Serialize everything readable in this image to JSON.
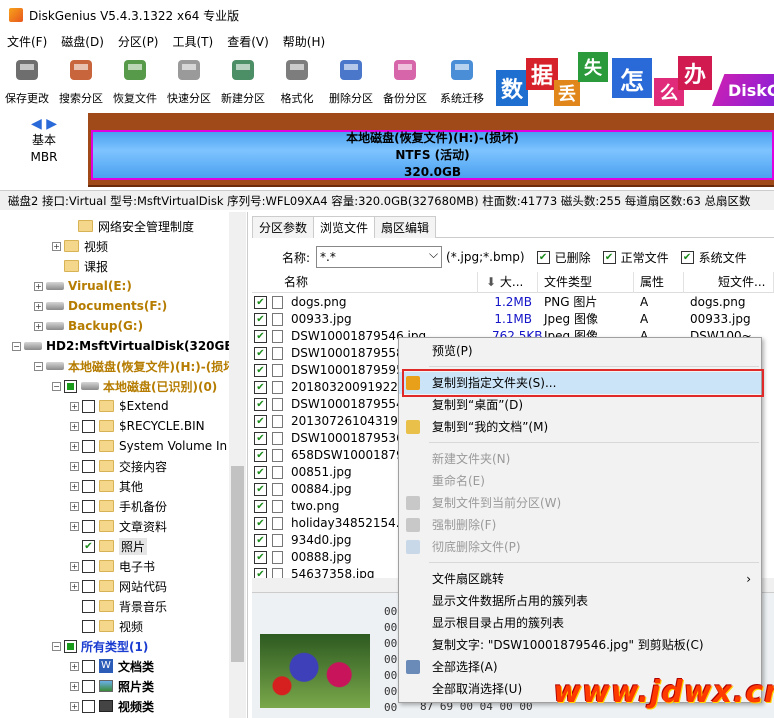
{
  "app": {
    "title": "DiskGenius V5.4.3.1322 x64 专业版"
  },
  "menu": [
    "文件(F)",
    "磁盘(D)",
    "分区(P)",
    "工具(T)",
    "查看(V)",
    "帮助(H)"
  ],
  "toolbar": [
    {
      "label": "保存更改",
      "icon": "save-disk-icon"
    },
    {
      "label": "搜索分区",
      "icon": "magnifier-icon"
    },
    {
      "label": "恢复文件",
      "icon": "recover-box-icon"
    },
    {
      "label": "快速分区",
      "icon": "disc-icon"
    },
    {
      "label": "新建分区",
      "icon": "layers-icon"
    },
    {
      "label": "格式化",
      "icon": "gear-disc-icon"
    },
    {
      "label": "删除分区",
      "icon": "trash-icon"
    },
    {
      "label": "备份分区",
      "icon": "pie-icon"
    },
    {
      "label": "系统迁移",
      "icon": "windows-migrate-icon"
    }
  ],
  "banner": {
    "chars": [
      "数",
      "据",
      "丢",
      "失",
      "怎",
      "么",
      "办"
    ],
    "text": "DiskG"
  },
  "disk": {
    "type_line1": "基本",
    "type_line2": "MBR",
    "partition_title": "本地磁盘(恢复文件)(H:)-(损坏)",
    "fs": "NTFS (活动)",
    "size": "320.0GB"
  },
  "infobar": "磁盘2 接口:Virtual  型号:MsftVirtualDisk  序列号:WFL09XA4  容量:320.0GB(327680MB)  柱面数:41773  磁头数:255  每道扇区数:63  总扇区数",
  "tree": [
    {
      "label": "网络安全管理制度",
      "indent": 66,
      "kind": "folder",
      "color": "#000"
    },
    {
      "label": "视频",
      "indent": 52,
      "kind": "folder",
      "exp": "+",
      "color": "#000"
    },
    {
      "label": "课报",
      "indent": 52,
      "kind": "folder",
      "color": "#000"
    },
    {
      "label": "Virual(E:)",
      "indent": 34,
      "kind": "drive",
      "exp": "+",
      "color": "#b57c00",
      "bold": true
    },
    {
      "label": "Documents(F:)",
      "indent": 34,
      "kind": "drive",
      "exp": "+",
      "color": "#b57c00",
      "bold": true
    },
    {
      "label": "Backup(G:)",
      "indent": 34,
      "kind": "drive",
      "exp": "+",
      "color": "#b57c00",
      "bold": true
    },
    {
      "label": "HD2:MsftVirtualDisk(320GB)",
      "indent": 12,
      "kind": "hdd",
      "exp": "−",
      "color": "#000",
      "bold": true
    },
    {
      "label": "本地磁盘(恢复文件)(H:)-(损坏",
      "indent": 34,
      "kind": "drive",
      "exp": "−",
      "color": "#b57c00",
      "bold": true
    },
    {
      "label": "本地磁盘(已识别)(0)",
      "indent": 52,
      "kind": "drive",
      "exp": "−",
      "check": "part",
      "color": "#b57c00",
      "bold": true
    },
    {
      "label": "$Extend",
      "indent": 70,
      "kind": "folder",
      "exp": "+",
      "check": "off",
      "color": "#000"
    },
    {
      "label": "$RECYCLE.BIN",
      "indent": 70,
      "kind": "folder",
      "exp": "+",
      "check": "off",
      "color": "#000"
    },
    {
      "label": "System Volume In",
      "indent": 70,
      "kind": "folder",
      "exp": "+",
      "check": "off",
      "color": "#000"
    },
    {
      "label": "交接内容",
      "indent": 70,
      "kind": "folder",
      "exp": "+",
      "check": "off",
      "color": "#000"
    },
    {
      "label": "其他",
      "indent": 70,
      "kind": "folder",
      "exp": "+",
      "check": "off",
      "color": "#000"
    },
    {
      "label": "手机备份",
      "indent": 70,
      "kind": "folder",
      "exp": "+",
      "check": "off",
      "color": "#000"
    },
    {
      "label": "文章资料",
      "indent": 70,
      "kind": "folder",
      "exp": "+",
      "check": "off",
      "color": "#000"
    },
    {
      "label": "照片",
      "indent": 70,
      "kind": "folder",
      "check": "on",
      "color": "#000",
      "selected": true
    },
    {
      "label": "电子书",
      "indent": 70,
      "kind": "folder",
      "exp": "+",
      "check": "off",
      "color": "#000"
    },
    {
      "label": "网站代码",
      "indent": 70,
      "kind": "folder",
      "exp": "+",
      "check": "off",
      "color": "#000"
    },
    {
      "label": "背景音乐",
      "indent": 70,
      "kind": "folder",
      "check": "off",
      "color": "#000"
    },
    {
      "label": "视频",
      "indent": 70,
      "kind": "folder",
      "check": "off",
      "color": "#000"
    },
    {
      "label": "所有类型(1)",
      "indent": 52,
      "kind": "none",
      "exp": "−",
      "check": "part",
      "color": "#1a3cd0",
      "bold": true
    },
    {
      "label": "文档类",
      "indent": 70,
      "kind": "doc",
      "exp": "+",
      "check": "off",
      "color": "#000",
      "bold": true
    },
    {
      "label": "照片类",
      "indent": 70,
      "kind": "img",
      "exp": "+",
      "check": "off",
      "color": "#000",
      "bold": true
    },
    {
      "label": "视频类",
      "indent": 70,
      "kind": "vid",
      "exp": "+",
      "check": "off",
      "color": "#000",
      "bold": true
    }
  ],
  "tabs": [
    "分区参数",
    "浏览文件",
    "扇区编辑"
  ],
  "filter": {
    "name_label": "名称:",
    "name_value": "*.*",
    "ext_hint": "(*.jpg;*.bmp)",
    "opt1": "已删除",
    "opt2": "正常文件",
    "opt3": "系统文件"
  },
  "columns": {
    "name": "名称",
    "size": "大...",
    "type": "文件类型",
    "attr": "属性",
    "short": "短文件..."
  },
  "files": [
    {
      "name": "dogs.png",
      "size": "1.2MB",
      "type": "PNG 图片",
      "attr": "A",
      "short": "dogs.png"
    },
    {
      "name": "00933.jpg",
      "size": "1.1MB",
      "type": "Jpeg 图像",
      "attr": "A",
      "short": "00933.jpg"
    },
    {
      "name": "DSW10001879546.jpg",
      "size": "762.5KB",
      "type": "Jpeg 图像",
      "attr": "A",
      "short": "DSW100~..."
    },
    {
      "name": "DSW100018795587",
      "size": "",
      "type": "",
      "attr": "",
      "short": ""
    },
    {
      "name": "DSW10001879595.jpg",
      "size": "",
      "type": "",
      "attr": "",
      "short": ""
    },
    {
      "name": "20180320091922.p",
      "size": "",
      "type": "",
      "attr": "",
      "short": ""
    },
    {
      "name": "DSW10001879554.",
      "size": "",
      "type": "",
      "attr": "",
      "short": ""
    },
    {
      "name": "20130726104319.g",
      "size": "",
      "type": "",
      "attr": "",
      "short": ""
    },
    {
      "name": "DSW10001879536.",
      "size": "",
      "type": "",
      "attr": "",
      "short": ""
    },
    {
      "name": "658DSW10001879",
      "size": "",
      "type": "",
      "attr": "",
      "short": ""
    },
    {
      "name": "00851.jpg",
      "size": "",
      "type": "",
      "attr": "",
      "short": ""
    },
    {
      "name": "00884.jpg",
      "size": "",
      "type": "",
      "attr": "",
      "short": ""
    },
    {
      "name": "two.png",
      "size": "",
      "type": "",
      "attr": "",
      "short": ""
    },
    {
      "name": "holiday34852154.p",
      "size": "",
      "type": "",
      "attr": "",
      "short": ""
    },
    {
      "name": "934d0.jpg",
      "size": "",
      "type": "",
      "attr": "",
      "short": ""
    },
    {
      "name": "00888.jpg",
      "size": "",
      "type": "",
      "attr": "",
      "short": ""
    },
    {
      "name": "54637358.jpg",
      "size": "",
      "type": "",
      "attr": "",
      "short": ""
    }
  ],
  "hex": [
    "00",
    "00",
    "00",
    "00",
    "00",
    "00",
    "00",
    "00",
    "0080:"
  ],
  "hex_tail": "87 69 00 04 00 00",
  "context_menu": [
    {
      "label": "预览(P)",
      "state": "enabled"
    },
    {
      "sep": true
    },
    {
      "label": "复制到指定文件夹(S)...",
      "state": "highlight",
      "icon": "copy-folder-icon"
    },
    {
      "label": "复制到“桌面”(D)",
      "state": "enabled"
    },
    {
      "label": "复制到“我的文档”(M)",
      "state": "enabled",
      "icon": "docs-folder-icon"
    },
    {
      "sep": true
    },
    {
      "label": "新建文件夹(N)",
      "state": "disabled"
    },
    {
      "label": "重命名(E)",
      "state": "disabled"
    },
    {
      "label": "复制文件到当前分区(W)",
      "state": "disabled",
      "icon": "copy-partition-icon"
    },
    {
      "label": "强制删除(F)",
      "state": "disabled",
      "icon": "force-delete-icon"
    },
    {
      "label": "彻底删除文件(P)",
      "state": "disabled",
      "icon": "wipe-icon"
    },
    {
      "sep": true
    },
    {
      "label": "文件扇区跳转",
      "state": "enabled",
      "submenu": "›"
    },
    {
      "label": "显示文件数据所占用的簇列表",
      "state": "enabled"
    },
    {
      "label": "显示根目录占用的簇列表",
      "state": "enabled"
    },
    {
      "label": "复制文字: \"DSW10001879546.jpg\" 到剪贴板(C)",
      "state": "enabled"
    },
    {
      "label": "全部选择(A)",
      "state": "enabled",
      "icon": "check-all-icon"
    },
    {
      "label": "全部取消选择(U)",
      "state": "enabled"
    }
  ],
  "watermark": "www.jdwx.cn"
}
